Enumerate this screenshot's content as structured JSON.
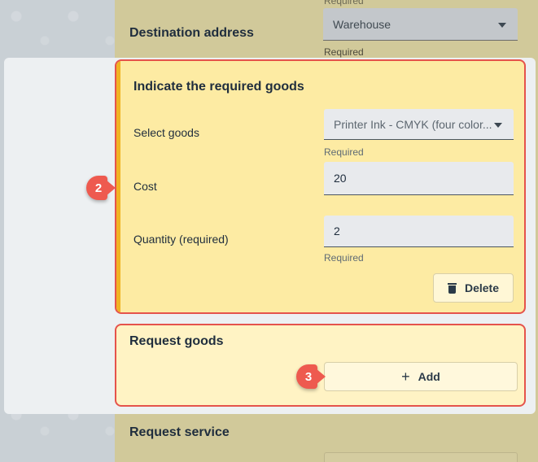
{
  "top": {
    "required_above": "Required",
    "destination_label": "Destination address",
    "destination_value": "Warehouse",
    "destination_helper": "Required"
  },
  "goods_card": {
    "title": "Indicate the required goods",
    "select_goods_label": "Select goods",
    "select_goods_value": "Printer Ink - CMYK (four color...",
    "select_goods_helper": "Required",
    "cost_label": "Cost",
    "cost_value": "20",
    "quantity_label": "Quantity (required)",
    "quantity_value": "2",
    "quantity_helper": "Required",
    "delete_label": "Delete"
  },
  "request_card": {
    "title": "Request goods",
    "add_label": "Add"
  },
  "bottom": {
    "request_service_label": "Request service"
  },
  "markers": {
    "step_2": "2",
    "step_3": "3"
  },
  "colors": {
    "highlight_border": "#e5534b",
    "marker": "#ee5a4f",
    "card_yellow": "#fdeba3",
    "accent": "#f0b323"
  },
  "icons": [
    "chevron-down-icon",
    "trash-icon",
    "plus-icon"
  ]
}
